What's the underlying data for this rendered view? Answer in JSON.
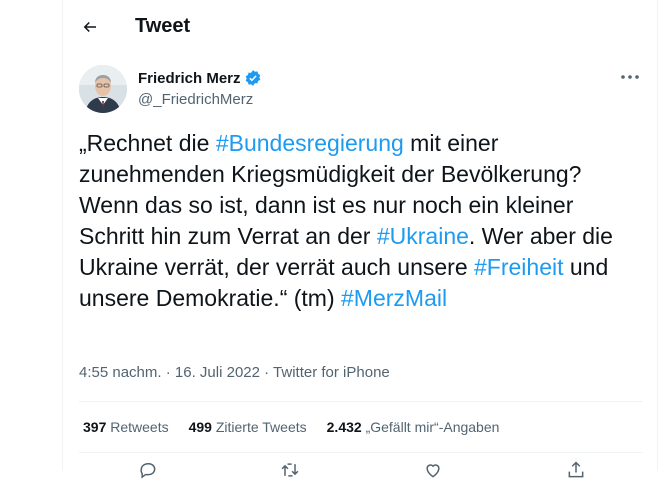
{
  "header": {
    "title": "Tweet"
  },
  "author": {
    "name": "Friedrich Merz",
    "handle": "@_FriedrichMerz"
  },
  "tweet": {
    "t1": "„Rechnet die ",
    "h1": "#Bundesregierung",
    "t2": " mit einer zunehmenden Kriegsmüdigkeit der Bevölkerung? Wenn das so ist, dann ist es nur noch ein kleiner Schritt hin zum Verrat an der ",
    "h2": "#Ukraine",
    "t3": ". Wer aber die Ukraine verrät, der verrät auch unsere ",
    "h3": "#Freiheit",
    "t4": " und unsere Demokratie.“ (tm) ",
    "h4": "#MerzMail"
  },
  "meta": {
    "time": "4:55 nachm.",
    "sep1": " · ",
    "date": "16. Juli 2022",
    "sep2": " · ",
    "source": "Twitter for iPhone"
  },
  "stats": {
    "retweets_count": "397",
    "retweets_label": " Retweets",
    "quotes_count": "499",
    "quotes_label": " Zitierte Tweets",
    "likes_count": "2.432",
    "likes_label": " „Gefällt mir“-Angaben"
  },
  "colors": {
    "accent": "#1d9bf0",
    "text": "#0f1419",
    "muted": "#536471",
    "divider": "#eff3f4"
  },
  "icons": [
    "back-arrow-icon",
    "verified-badge-icon",
    "more-icon",
    "reply-icon",
    "retweet-icon",
    "like-icon",
    "share-icon"
  ]
}
